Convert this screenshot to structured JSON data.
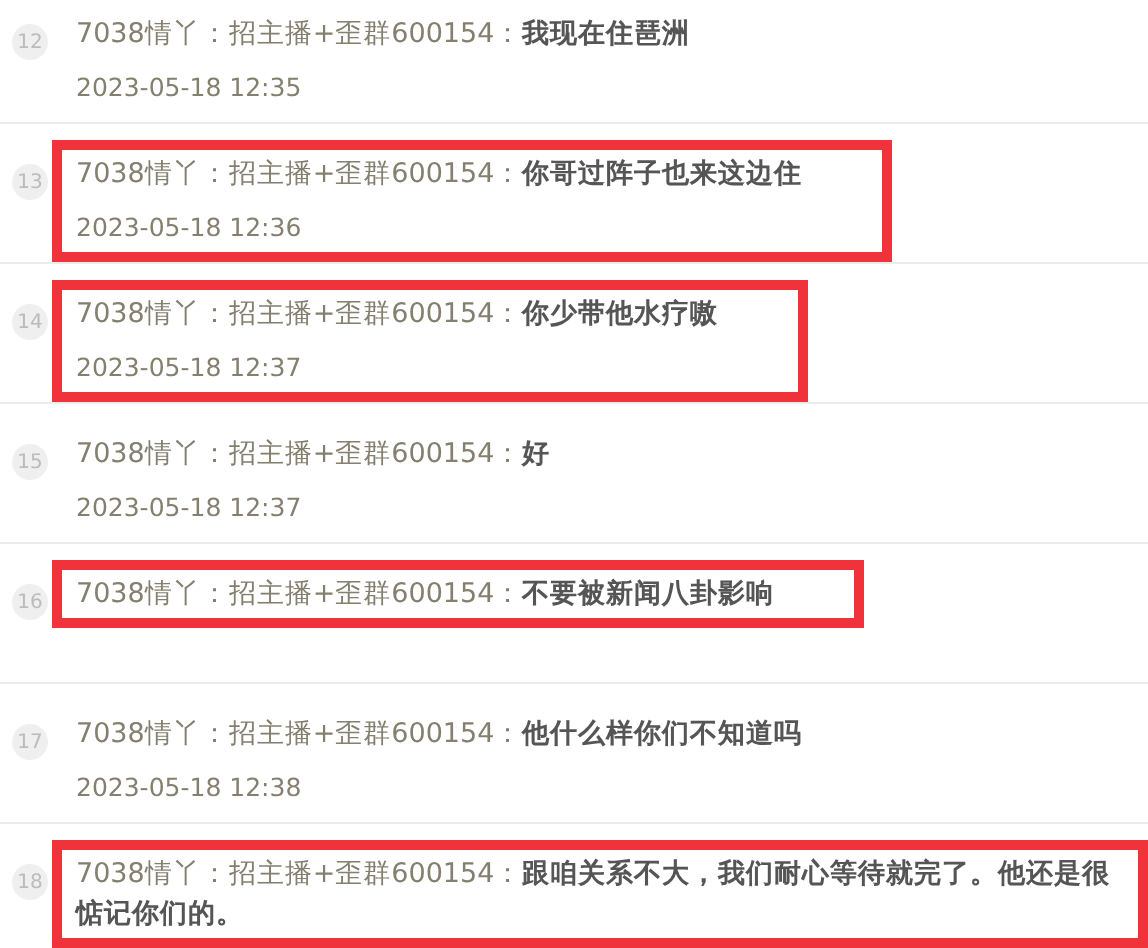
{
  "messages": [
    {
      "index": "12",
      "sender": "7038情丫：招主播+歪群600154：",
      "text": "我现在住琶洲",
      "time": "2023-05-18 12:35",
      "highlighted": false
    },
    {
      "index": "13",
      "sender": "7038情丫：招主播+歪群600154：",
      "text": "你哥过阵子也来这边住",
      "time": "2023-05-18 12:36",
      "highlighted": true
    },
    {
      "index": "14",
      "sender": "7038情丫：招主播+歪群600154：",
      "text": "你少带他水疗嗷",
      "time": "2023-05-18 12:37",
      "highlighted": true
    },
    {
      "index": "15",
      "sender": "7038情丫：招主播+歪群600154：",
      "text": "好",
      "time": "2023-05-18 12:37",
      "highlighted": false
    },
    {
      "index": "16",
      "sender": "7038情丫：招主播+歪群600154：",
      "text": "不要被新闻八卦影响",
      "highlighted": true
    },
    {
      "index": "17",
      "sender": "7038情丫：招主播+歪群600154：",
      "text": "他什么样你们不知道吗",
      "time": "2023-05-18 12:38",
      "highlighted": false
    },
    {
      "index": "18",
      "sender": "7038情丫：招主播+歪群600154：",
      "text": "跟咱关系不大，我们耐心等待就完了。他还是很惦记你们的。",
      "highlighted": true
    }
  ]
}
